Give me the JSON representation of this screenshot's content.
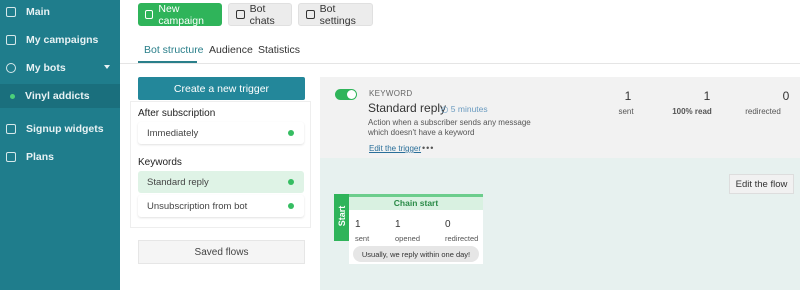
{
  "sidebar": {
    "items": [
      {
        "label": "Main",
        "icon": "dashboard-icon"
      },
      {
        "label": "My campaigns",
        "icon": "campaigns-icon"
      },
      {
        "label": "My bots",
        "icon": "bot-icon"
      },
      {
        "label": "Vinyl addicts",
        "icon": "status-dot-icon"
      },
      {
        "label": "Signup widgets",
        "icon": "widget-icon"
      },
      {
        "label": "Plans",
        "icon": "plans-icon"
      }
    ]
  },
  "topbar": {
    "new_campaign": "New campaign",
    "bot_chats": "Bot chats",
    "bot_settings": "Bot settings"
  },
  "tabs": [
    "Bot structure",
    "Audience",
    "Statistics"
  ],
  "triggers": {
    "create_label": "Create a new trigger",
    "after_title": "After subscription",
    "after_items": [
      "Immediately"
    ],
    "keywords_title": "Keywords",
    "keyword_items": [
      "Standard reply",
      "Unsubscription from bot"
    ],
    "saved_flows": "Saved flows"
  },
  "trigger_detail": {
    "type": "KEYWORD",
    "name": "Standard reply",
    "delay": "5 minutes",
    "description": "Action when a subscriber sends any message which doesn't have a keyword",
    "edit_link": "Edit the trigger",
    "more": "•••",
    "stats": [
      {
        "value": "1",
        "label": "sent"
      },
      {
        "value": "1",
        "label": "100% read"
      },
      {
        "value": "0",
        "label": "redirected"
      }
    ],
    "edit_flow": "Edit the flow"
  },
  "chain": {
    "start_label": "Start",
    "title": "Chain start",
    "stats": [
      {
        "value": "1",
        "label": "sent"
      },
      {
        "value": "1",
        "label": "opened"
      },
      {
        "value": "0",
        "label": "redirected"
      }
    ],
    "message": "Usually, we reply within one day!"
  },
  "colors": {
    "sidebar": "#1f7d8c",
    "accent_green": "#2fb45a",
    "primary_teal": "#23879a"
  }
}
